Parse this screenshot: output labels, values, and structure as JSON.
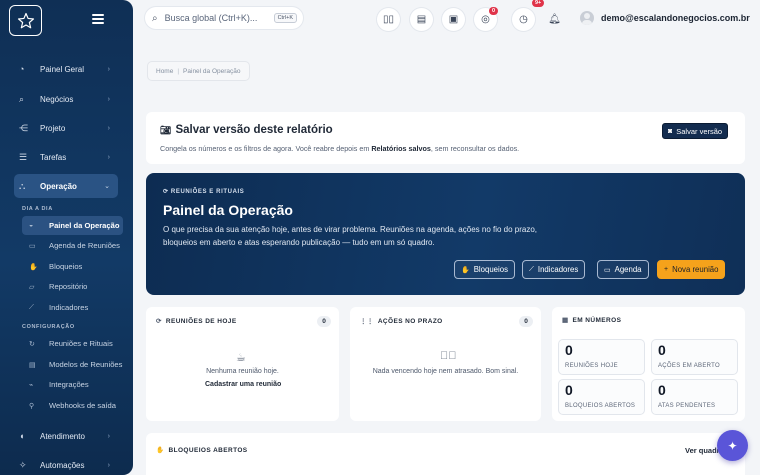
{
  "sidebar": {
    "items": [
      {
        "label": "Painel Geral",
        "icon": "speedometer-icon"
      },
      {
        "label": "Negócios",
        "icon": "search-icon"
      },
      {
        "label": "Projeto",
        "icon": "share-icon"
      },
      {
        "label": "Tarefas",
        "icon": "list-icon"
      },
      {
        "label": "Operação",
        "icon": "network-icon"
      },
      {
        "label": "Atendimento",
        "icon": "headset-icon"
      },
      {
        "label": "Automações",
        "icon": "sparkle-icon"
      }
    ],
    "section_dia": "DIA A DIA",
    "dia_items": [
      {
        "label": "Painel da Operação",
        "icon": "gauge-icon"
      },
      {
        "label": "Agenda de Reuniões",
        "icon": "calendar-icon"
      },
      {
        "label": "Bloqueios",
        "icon": "hand-icon"
      },
      {
        "label": "Repositório",
        "icon": "folder-icon"
      },
      {
        "label": "Indicadores",
        "icon": "chart-icon"
      }
    ],
    "section_config": "CONFIGURAÇÃO",
    "config_items": [
      {
        "label": "Reuniões e Rituais",
        "icon": "refresh-icon"
      },
      {
        "label": "Modelos de Reuniões",
        "icon": "template-icon"
      },
      {
        "label": "Integrações",
        "icon": "plug-icon"
      },
      {
        "label": "Webhooks de saída",
        "icon": "webhook-icon"
      }
    ]
  },
  "topbar": {
    "search_placeholder": "Busca global (Ctrl+K)...",
    "shortcut": "Ctrl+K",
    "whatsapp_badge": "0",
    "timer_badge": "9+",
    "user_email": "demo@escalandonegocios.com.br"
  },
  "breadcrumb": {
    "home": "Home",
    "current": "Painel da Operação"
  },
  "save_card": {
    "title": "Salvar versão deste relatório",
    "desc_before": "Congela os números e os filtros de agora. Você reabre depois em ",
    "desc_link": "Relatórios salvos",
    "desc_after": ", sem reconsultar os dados.",
    "button": "Salvar versão"
  },
  "hero": {
    "eyebrow": "REUNIÕES E RITUAIS",
    "title": "Painel da Operação",
    "description": "O que precisa da sua atenção hoje, antes de virar problema. Reuniões na agenda, ações no fio do prazo, bloqueios em aberto e atas esperando publicação — tudo em um só quadro.",
    "buttons": [
      "Bloqueios",
      "Indicadores",
      "Agenda",
      "Nova reunião"
    ]
  },
  "meetings_today": {
    "title": "REUNIÕES DE HOJE",
    "count": "0",
    "empty": "Nenhuma reunião hoje.",
    "link": "Cadastrar uma reunião"
  },
  "actions_due": {
    "title": "AÇÕES NO PRAZO",
    "count": "0",
    "empty": "Nada vencendo hoje nem atrasado. Bom sinal."
  },
  "numbers": {
    "title": "EM NÚMEROS",
    "stats": [
      {
        "value": "0",
        "label": "REUNIÕES HOJE"
      },
      {
        "value": "0",
        "label": "AÇÕES EM ABERTO"
      },
      {
        "value": "0",
        "label": "BLOQUEIOS ABERTOS"
      },
      {
        "value": "0",
        "label": "ATAS PENDENTES"
      }
    ]
  },
  "blocks": {
    "title": "BLOQUEIOS ABERTOS",
    "link": "Ver quadro"
  }
}
